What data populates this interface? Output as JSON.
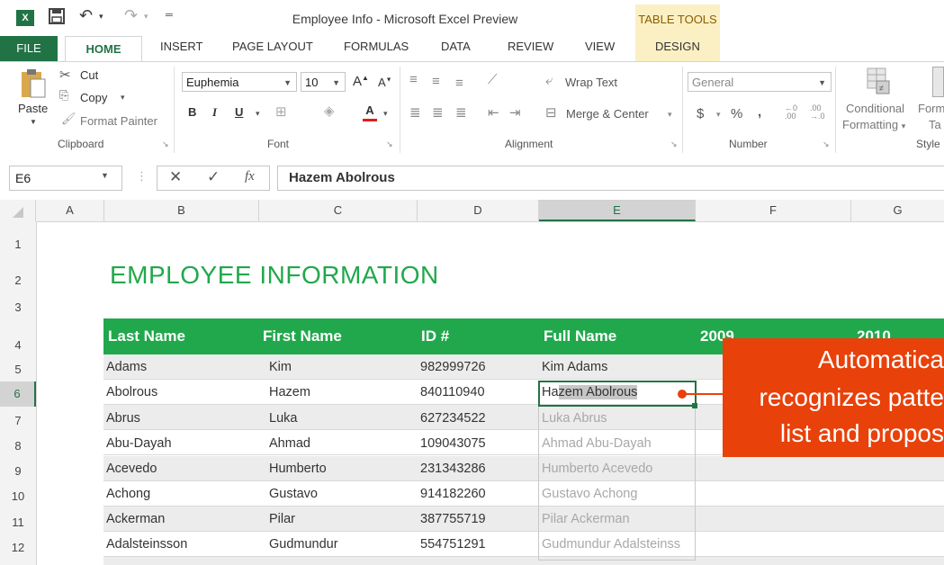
{
  "app": {
    "title": "Employee Info - Microsoft Excel Preview",
    "logo": "X",
    "contextual_group": "TABLE TOOLS"
  },
  "quick_access": {
    "save_icon": "save-icon",
    "undo_icon": "undo-icon",
    "redo_icon": "redo-icon"
  },
  "tabs": [
    "FILE",
    "HOME",
    "INSERT",
    "PAGE LAYOUT",
    "FORMULAS",
    "DATA",
    "REVIEW",
    "VIEW",
    "DESIGN"
  ],
  "ribbon": {
    "clipboard": {
      "group": "Clipboard",
      "paste": "Paste",
      "cut": "Cut",
      "copy": "Copy",
      "format_painter": "Format Painter"
    },
    "font": {
      "group": "Font",
      "name": "Euphemia",
      "size": "10",
      "bold": "B",
      "italic": "I",
      "underline": "U",
      "grow": "A",
      "shrink": "A",
      "color_a": "A"
    },
    "alignment": {
      "group": "Alignment",
      "wrap": "Wrap Text",
      "merge": "Merge & Center"
    },
    "number": {
      "group": "Number",
      "format": "General",
      "currency": "$",
      "percent": "%",
      "comma": ","
    },
    "styles": {
      "group": "Style",
      "conditional_1": "Conditional",
      "conditional_2": "Formatting",
      "format_as_1": "Form",
      "format_as_2": "Ta"
    }
  },
  "formula_bar": {
    "name_box": "E6",
    "cancel": "✕",
    "enter": "✓",
    "fx": "fx",
    "value": "Hazem Abolrous"
  },
  "columns": [
    "A",
    "B",
    "C",
    "D",
    "E",
    "F",
    "G"
  ],
  "rows": [
    "1",
    "2",
    "3",
    "4",
    "5",
    "6",
    "7",
    "8",
    "9",
    "10",
    "11",
    "12"
  ],
  "sheet_title": "EMPLOYEE INFORMATION",
  "table": {
    "headers": [
      "Last Name",
      "First Name",
      "ID #",
      "Full Name",
      "2009",
      "2010"
    ],
    "rows": [
      {
        "last": "Adams",
        "first": "Kim",
        "id": "982999726",
        "full": "Kim Adams"
      },
      {
        "last": "Abolrous",
        "first": "Hazem",
        "id": "840110940",
        "full_a": "Ha",
        "full_b": "zem Abolrous"
      },
      {
        "last": "Abrus",
        "first": "Luka",
        "id": "627234522",
        "full": "Luka Abrus"
      },
      {
        "last": "Abu-Dayah",
        "first": "Ahmad",
        "id": "109043075",
        "full": "Ahmad Abu-Dayah"
      },
      {
        "last": "Acevedo",
        "first": "Humberto",
        "id": "231343286",
        "full": "Humberto Acevedo"
      },
      {
        "last": "Achong",
        "first": "Gustavo",
        "id": "914182260",
        "full": "Gustavo Achong"
      },
      {
        "last": "Ackerman",
        "first": "Pilar",
        "id": "387755719",
        "full": "Pilar Ackerman"
      },
      {
        "last": "Adalsteinsson",
        "first": "Gudmundur",
        "id": "554751291",
        "full": "Gudmundur Adalsteinss"
      }
    ]
  },
  "callout": {
    "line1": "Automatica",
    "line2": "recognizes patte",
    "line3": "list and propos"
  },
  "colors": {
    "excel_green": "#217346",
    "table_green": "#21a84c",
    "callout_orange": "#e8410a"
  }
}
